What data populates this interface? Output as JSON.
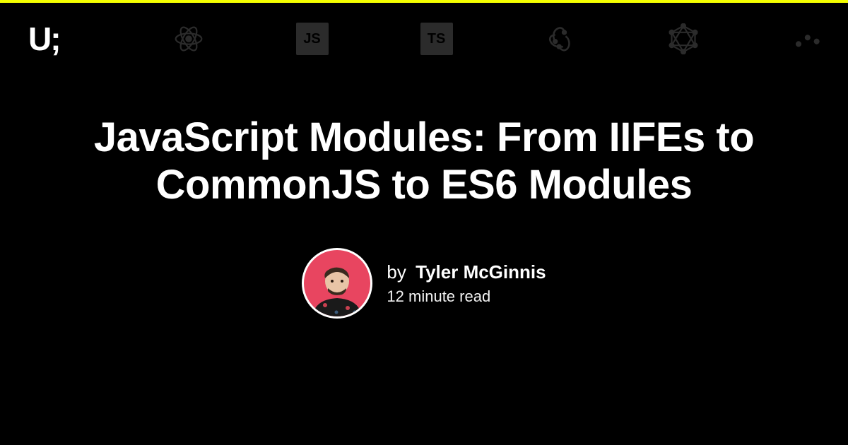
{
  "brand": {
    "logo_text": "U;"
  },
  "nav_icons": [
    {
      "name": "react-icon"
    },
    {
      "name": "javascript-icon",
      "badge": "JS"
    },
    {
      "name": "typescript-icon",
      "badge": "TS"
    },
    {
      "name": "redux-icon"
    },
    {
      "name": "graphql-icon"
    },
    {
      "name": "dots-icon"
    }
  ],
  "article": {
    "title": "JavaScript Modules: From IIFEs to CommonJS to ES6 Modules",
    "by_label": "by",
    "author_name": "Tyler McGinnis",
    "read_time": "12 minute read"
  },
  "colors": {
    "accent_bar": "#f5ff00",
    "avatar_bg": "#e84560",
    "muted_icon": "#2b2b2b"
  }
}
